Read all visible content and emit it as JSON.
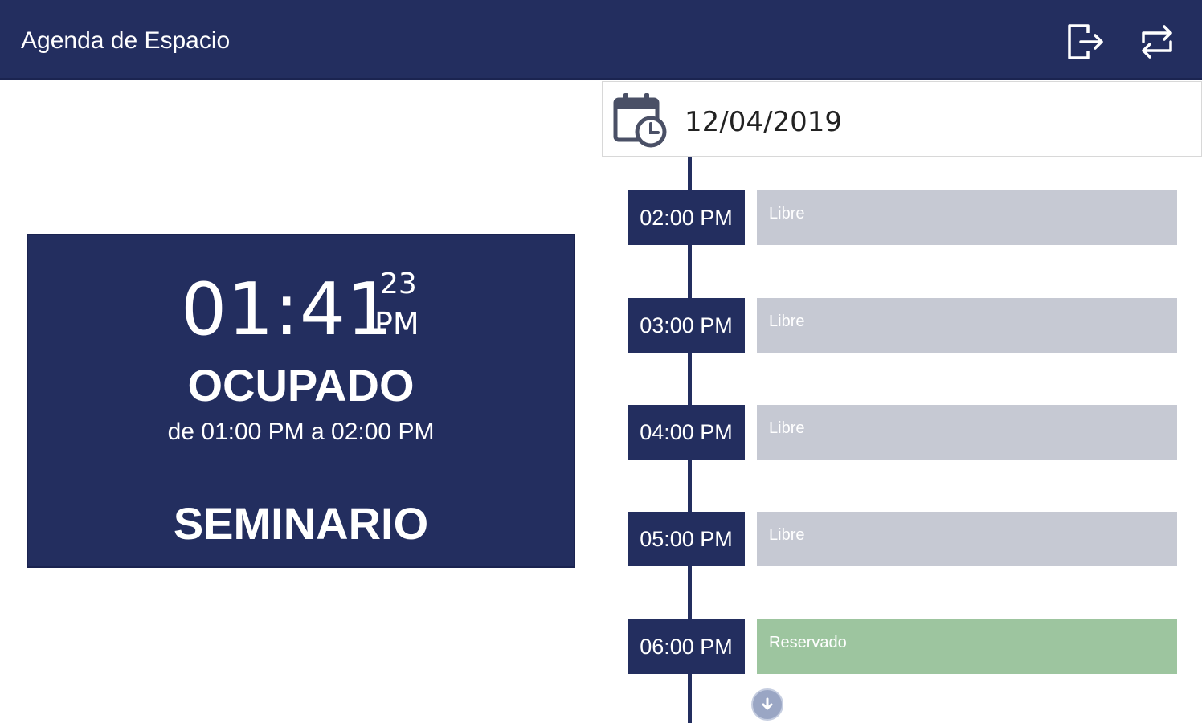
{
  "header": {
    "title": "Agenda de Espacio",
    "bg_color": "#232e5f",
    "actions": [
      {
        "icon": "logout-icon"
      },
      {
        "icon": "swap-icon"
      }
    ]
  },
  "date_picker": {
    "icon": "calendar-clock-icon",
    "value": "12/04/2019"
  },
  "status": {
    "clock_hm": "01:41",
    "clock_seconds": "23",
    "clock_ampm": "PM",
    "label": "OCUPADO",
    "range": "de 01:00 PM a 02:00 PM",
    "event": "SEMINARIO"
  },
  "timeline": {
    "slots": [
      {
        "time": "02:00 PM",
        "state": "Libre"
      },
      {
        "time": "03:00 PM",
        "state": "Libre"
      },
      {
        "time": "04:00 PM",
        "state": "Libre"
      },
      {
        "time": "05:00 PM",
        "state": "Libre"
      },
      {
        "time": "06:00 PM",
        "state": "Reservado"
      }
    ],
    "colors": {
      "libre": "#c6c9d3",
      "reservado": "#9dc59f",
      "label": "#232e5f"
    },
    "scroll_icon": "arrow-down-icon"
  }
}
